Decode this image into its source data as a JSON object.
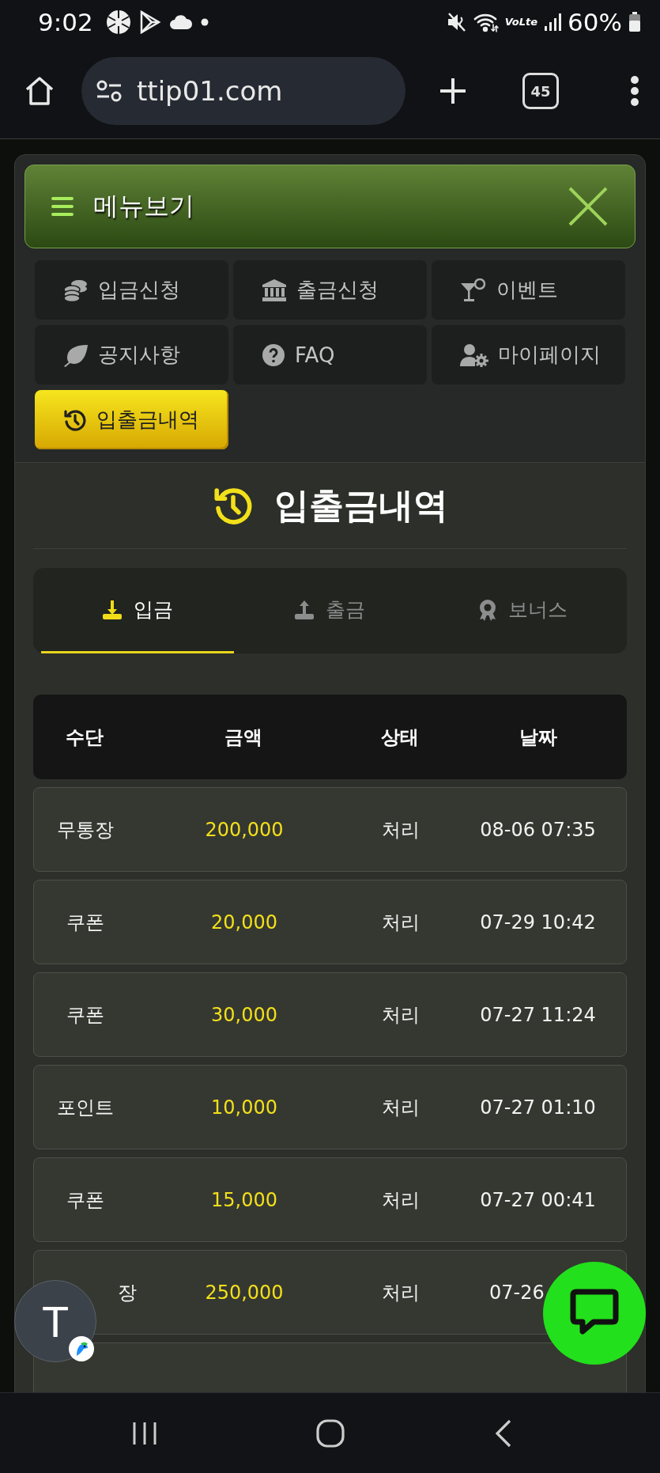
{
  "status_bar": {
    "time": "9:02",
    "network": "VoLte",
    "battery": "60%"
  },
  "browser": {
    "url": "ttip01.com",
    "tab_count": "45"
  },
  "menu": {
    "title": "메뉴보기",
    "items": [
      {
        "label": "입금신청",
        "selected": false
      },
      {
        "label": "출금신청",
        "selected": false
      },
      {
        "label": "이벤트",
        "selected": false
      },
      {
        "label": "공지사항",
        "selected": false
      },
      {
        "label": "FAQ",
        "selected": false
      },
      {
        "label": "마이페이지",
        "selected": false
      },
      {
        "label": "입출금내역",
        "selected": true
      }
    ]
  },
  "history": {
    "title": "입출금내역",
    "tabs": [
      {
        "label": "입금",
        "selected": true
      },
      {
        "label": "출금",
        "selected": false
      },
      {
        "label": "보너스",
        "selected": false
      }
    ],
    "table": {
      "columns": [
        "수단",
        "금액",
        "상태",
        "날짜"
      ],
      "rows": [
        {
          "method": "무통장",
          "amount": "200,000",
          "status": "처리",
          "date": "08-06 07:35",
          "clipped": false
        },
        {
          "method": "쿠폰",
          "amount": "20,000",
          "status": "처리",
          "date": "07-29 10:42",
          "clipped": false
        },
        {
          "method": "쿠폰",
          "amount": "30,000",
          "status": "처리",
          "date": "07-27 11:24",
          "clipped": false
        },
        {
          "method": "포인트",
          "amount": "10,000",
          "status": "처리",
          "date": "07-27 01:10",
          "clipped": false
        },
        {
          "method": "쿠폰",
          "amount": "15,000",
          "status": "처리",
          "date": "07-27 00:41",
          "clipped": false
        },
        {
          "method": "장",
          "amount": "250,000",
          "status": "처리",
          "date": "07-26",
          "clipped": true
        }
      ]
    }
  },
  "chat_avatar": {
    "letter": "T"
  }
}
